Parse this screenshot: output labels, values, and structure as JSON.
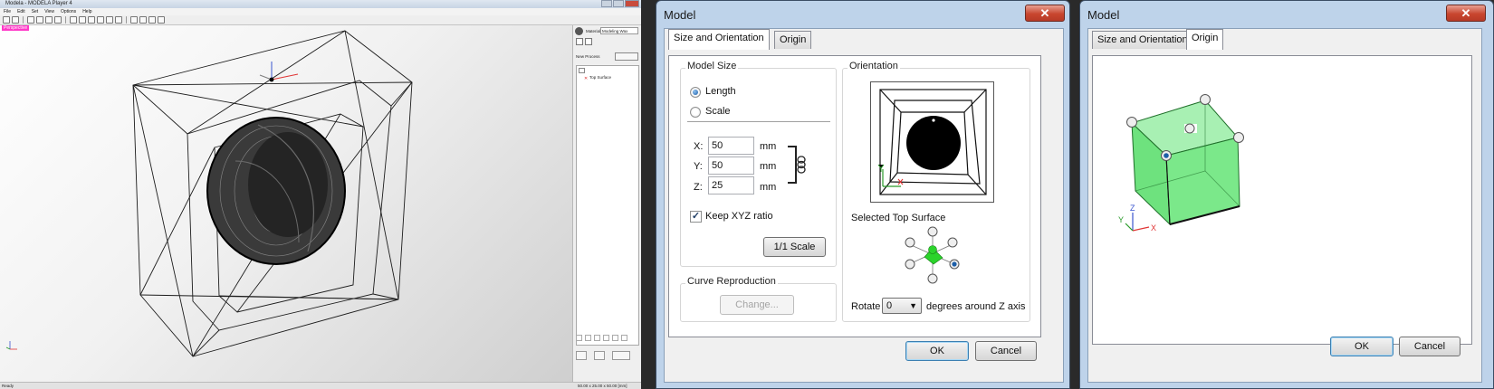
{
  "app": {
    "title": "Modela - MODELA Player 4",
    "menu": [
      "File",
      "Edit",
      "Set",
      "View",
      "Options",
      "Help"
    ],
    "view_label": "Perspective",
    "material_label": "Material",
    "material_value": "Modeling Wax",
    "new_process_label": "New Process",
    "tree_item": "Top Surface",
    "status_left": "Ready",
    "status_right": "50.00 x 25.00 x 50.00 [mm]"
  },
  "dialog1": {
    "title": "Model",
    "close_symbol": "✕",
    "tabs": [
      "Size and Orientation",
      "Origin"
    ],
    "model_size": {
      "title": "Model Size",
      "length_label": "Length",
      "scale_label": "Scale",
      "x_label": "X:",
      "x_value": "50",
      "y_label": "Y:",
      "y_value": "50",
      "z_label": "Z:",
      "z_value": "25",
      "unit": "mm",
      "keep_ratio_label": "Keep XYZ ratio",
      "keep_ratio_checked": true,
      "scale_button": "1/1 Scale"
    },
    "curve": {
      "title": "Curve Reproduction",
      "change_button": "Change..."
    },
    "orientation": {
      "title": "Orientation",
      "selected_surface_label": "Selected Top Surface",
      "rotate_label": "Rotate",
      "rotate_value": "0",
      "rotate_suffix": "degrees around Z axis"
    },
    "ok": "OK",
    "cancel": "Cancel"
  },
  "dialog2": {
    "title": "Model",
    "close_symbol": "✕",
    "tabs": [
      "Size and Orientation",
      "Origin"
    ],
    "ok": "OK",
    "cancel": "Cancel"
  },
  "colors": {
    "dialog_frame": "#bed3ea",
    "cube_green": "#7be88a",
    "close_red": "#c8462f",
    "view_label_pink": "#ff39c8"
  }
}
